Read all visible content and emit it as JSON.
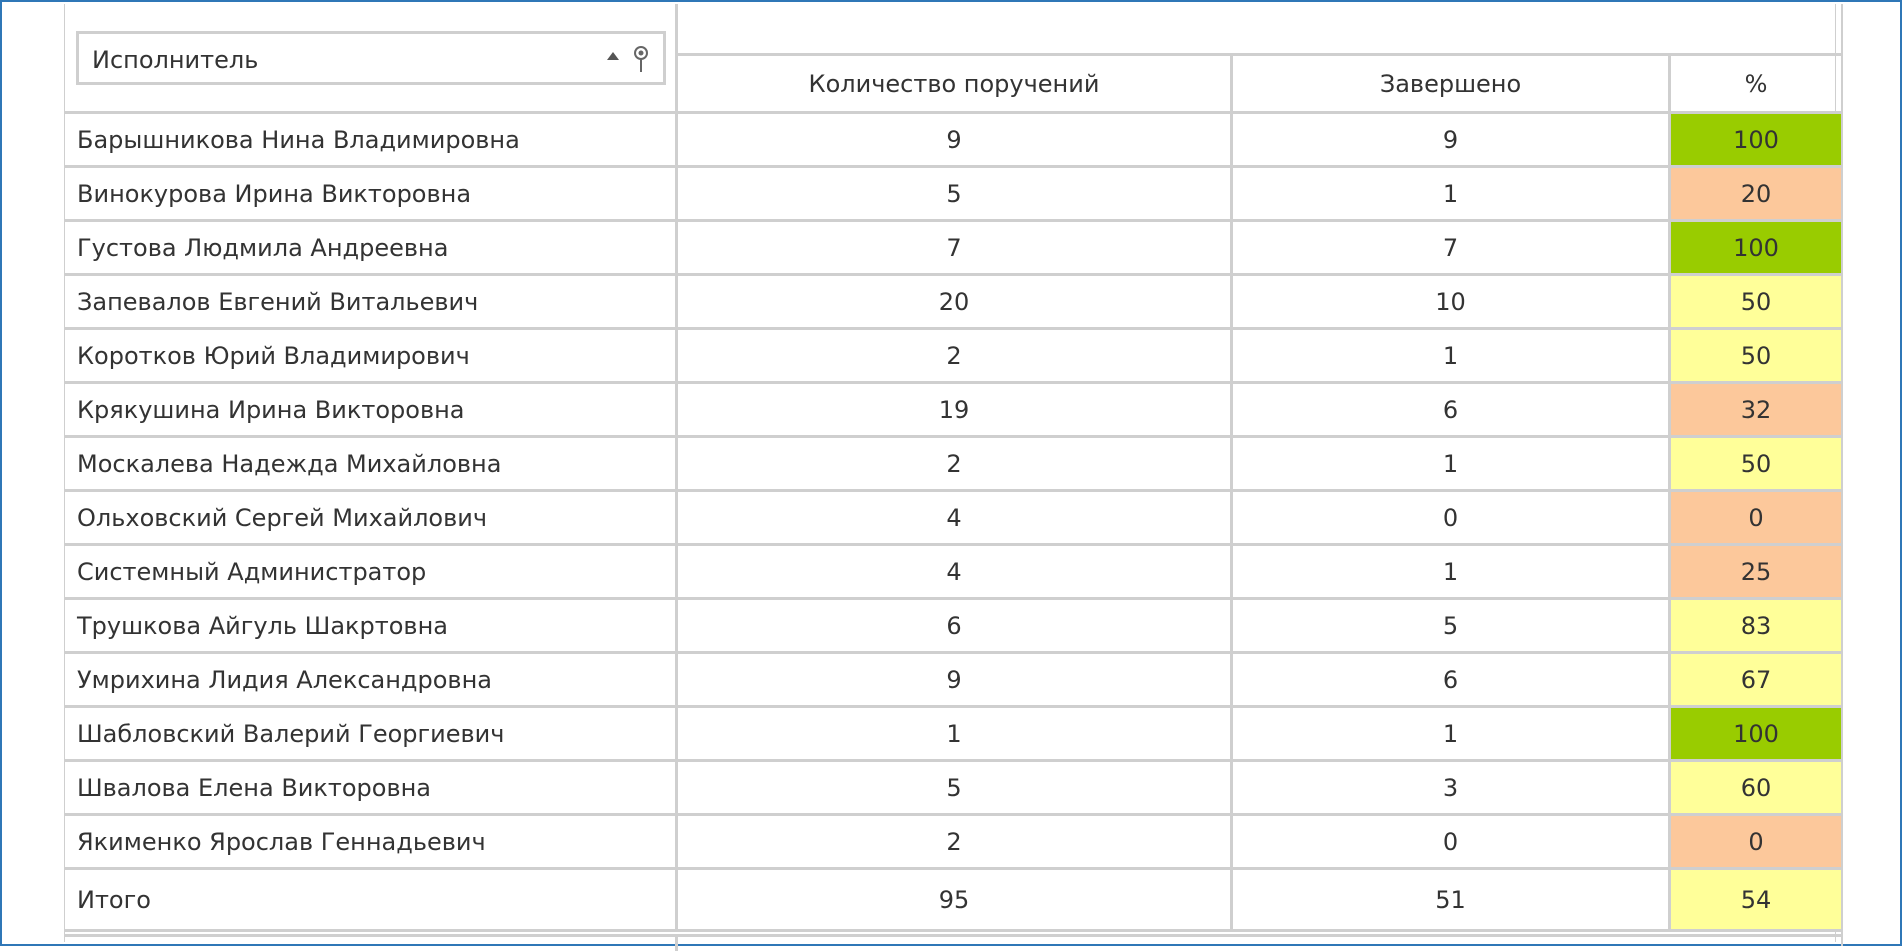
{
  "filter": {
    "label": "Исполнитель"
  },
  "columns": {
    "count": "Количество поручений",
    "done": "Завершено",
    "pct": "%"
  },
  "colors": {
    "green": "#99cc00",
    "orange": "#fcc89b",
    "yellow": "#ffff99",
    "grid": "#cfcfcf",
    "frame": "#2f77b7"
  },
  "rows": [
    {
      "name": "Барышникова Нина Владимировна",
      "count": "9",
      "done": "9",
      "pct": "100",
      "level": "green"
    },
    {
      "name": "Винокурова Ирина Викторовна",
      "count": "5",
      "done": "1",
      "pct": "20",
      "level": "orange"
    },
    {
      "name": "Густова Людмила Андреевна",
      "count": "7",
      "done": "7",
      "pct": "100",
      "level": "green"
    },
    {
      "name": "Запевалов Евгений Витальевич",
      "count": "20",
      "done": "10",
      "pct": "50",
      "level": "yellow"
    },
    {
      "name": "Коротков Юрий Владимирович",
      "count": "2",
      "done": "1",
      "pct": "50",
      "level": "yellow"
    },
    {
      "name": "Крякушина Ирина Викторовна",
      "count": "19",
      "done": "6",
      "pct": "32",
      "level": "orange"
    },
    {
      "name": "Москалева Надежда Михайловна",
      "count": "2",
      "done": "1",
      "pct": "50",
      "level": "yellow"
    },
    {
      "name": "Ольховский Сергей Михайлович",
      "count": "4",
      "done": "0",
      "pct": "0",
      "level": "orange"
    },
    {
      "name": "Системный Администратор",
      "count": "4",
      "done": "1",
      "pct": "25",
      "level": "orange"
    },
    {
      "name": "Трушкова Айгуль Шакртовна",
      "count": "6",
      "done": "5",
      "pct": "83",
      "level": "yellow"
    },
    {
      "name": "Умрихина Лидия Александровна",
      "count": "9",
      "done": "6",
      "pct": "67",
      "level": "yellow"
    },
    {
      "name": "Шабловский Валерий Георгиевич",
      "count": "1",
      "done": "1",
      "pct": "100",
      "level": "green"
    },
    {
      "name": "Швалова Елена Викторовна",
      "count": "5",
      "done": "3",
      "pct": "60",
      "level": "yellow"
    },
    {
      "name": "Якименко Ярослав Геннадьевич",
      "count": "2",
      "done": "0",
      "pct": "0",
      "level": "orange"
    }
  ],
  "total": {
    "name": "Итого",
    "count": "95",
    "done": "51",
    "pct": "54",
    "level": "yellow"
  }
}
